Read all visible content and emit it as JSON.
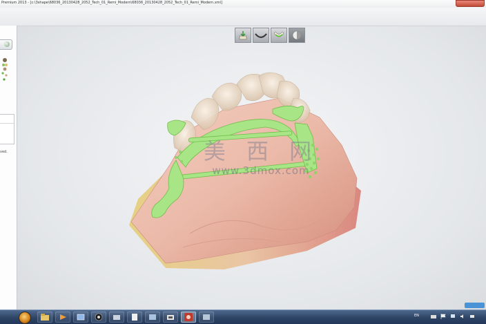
{
  "window": {
    "title": "Premium 2013 - [c:\\3shape\\68036_20130428_2052_Tech_01_Remi_Modern\\68036_20130428_2052_Tech_01_Remi_Modern.xml]"
  },
  "left_panel": {
    "status_text": "ved."
  },
  "toolbar": {
    "tools": [
      {
        "icon": "model-export-icon",
        "active": false
      },
      {
        "icon": "jaw-view-icon",
        "active": false
      },
      {
        "icon": "framework-view-icon",
        "active": false
      },
      {
        "icon": "transparency-icon",
        "active": true
      }
    ]
  },
  "watermark": {
    "chinese": "美 西 网",
    "url": "www.3dmox.com"
  },
  "taskbar": {
    "apps": [
      "explorer-icon",
      "media-icon",
      "viewer-icon",
      "network-icon",
      "settings-icon",
      "document-icon",
      "app-icon",
      "red-app-icon",
      "slides-icon"
    ],
    "language": "EN"
  },
  "colors": {
    "gum": "#e8b8a8",
    "framework": "#9be07a",
    "teeth": "#f1e0cc",
    "taskbar": "#2d4465"
  }
}
